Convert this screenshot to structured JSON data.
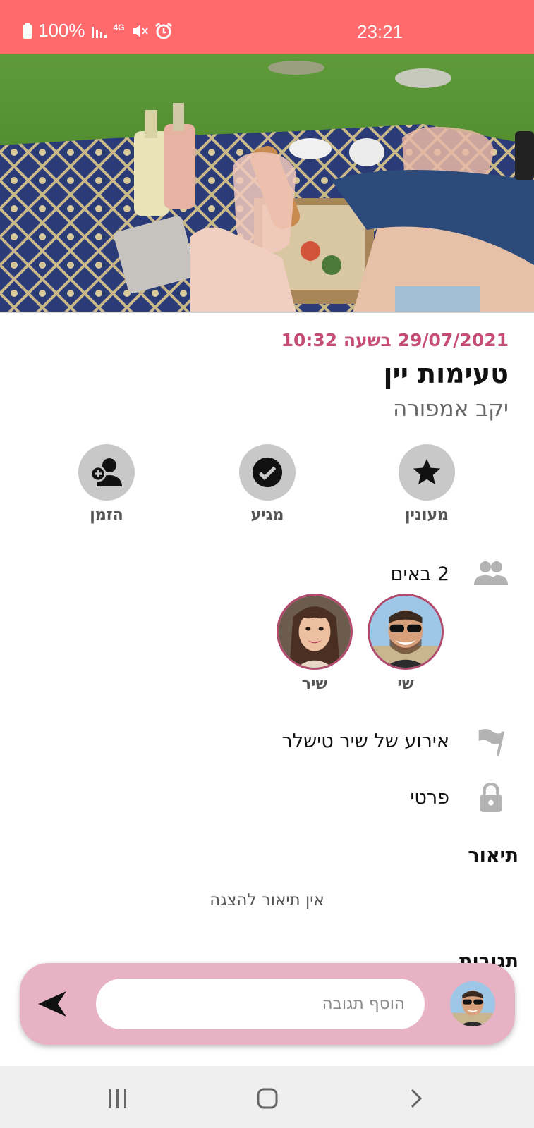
{
  "status_bar": {
    "battery": "100%",
    "network": "4G",
    "time": "23:21"
  },
  "event": {
    "date_time": "29/07/2021 בשעה 10:32",
    "title": "טעימות יין",
    "subtitle": "יקב אמפורה"
  },
  "actions": [
    {
      "label": "מעונין",
      "icon": "star-icon"
    },
    {
      "label": "מגיע",
      "icon": "check-icon"
    },
    {
      "label": "הזמן",
      "icon": "add-person-icon"
    }
  ],
  "attendees": {
    "count_label": "2 באים",
    "people": [
      {
        "name": "שי"
      },
      {
        "name": "שיר"
      }
    ]
  },
  "organizer": {
    "label": "אירוע של שיר טישלר",
    "icon": "flag-icon"
  },
  "privacy": {
    "label": "פרטי",
    "icon": "lock-icon"
  },
  "description": {
    "title": "תיאור",
    "empty_text": "אין תיאור להצגה"
  },
  "comments": {
    "title": "תגובות",
    "placeholder": "הוסף תגובה",
    "send_icon": "send-icon"
  },
  "nav": {
    "recents_icon": "recents-icon",
    "home_icon": "home-icon",
    "back_icon": "back-icon"
  },
  "colors": {
    "status_bar": "#ff6a6d",
    "accent": "#c64d77",
    "comment_bar": "#e8b2c5"
  }
}
